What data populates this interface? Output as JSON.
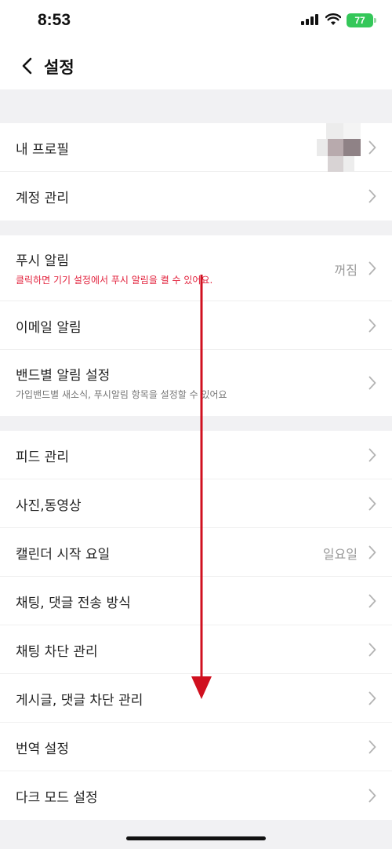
{
  "status": {
    "time": "8:53",
    "battery": "77"
  },
  "nav": {
    "title": "설정"
  },
  "groups": [
    {
      "rows": [
        {
          "title": "내 프로필"
        },
        {
          "title": "계정 관리"
        }
      ]
    },
    {
      "rows": [
        {
          "title": "푸시 알림",
          "subtitle": "클릭하면 기기 설정에서 푸시 알림을 켤 수 있어요.",
          "value": "꺼짐"
        },
        {
          "title": "이메일 알림"
        },
        {
          "title": "밴드별 알림 설정",
          "subtitle": "가입밴드별 새소식, 푸시알림 항목을 설정할 수 있어요"
        }
      ]
    },
    {
      "rows": [
        {
          "title": "피드 관리"
        },
        {
          "title": "사진,동영상"
        },
        {
          "title": "캘린더 시작 요일",
          "value": "일요일"
        },
        {
          "title": "채팅, 댓글 전송 방식"
        },
        {
          "title": "채팅 차단 관리"
        },
        {
          "title": "게시글, 댓글 차단 관리"
        },
        {
          "title": "번역 설정"
        },
        {
          "title": "다크 모드 설정"
        }
      ]
    }
  ],
  "colors": {
    "accent_red": "#e2213c",
    "battery_green": "#34c759",
    "arrow_red": "#d0101f"
  },
  "icons": {
    "back": "chevron-left-icon",
    "row_arrow": "chevron-right-icon"
  }
}
